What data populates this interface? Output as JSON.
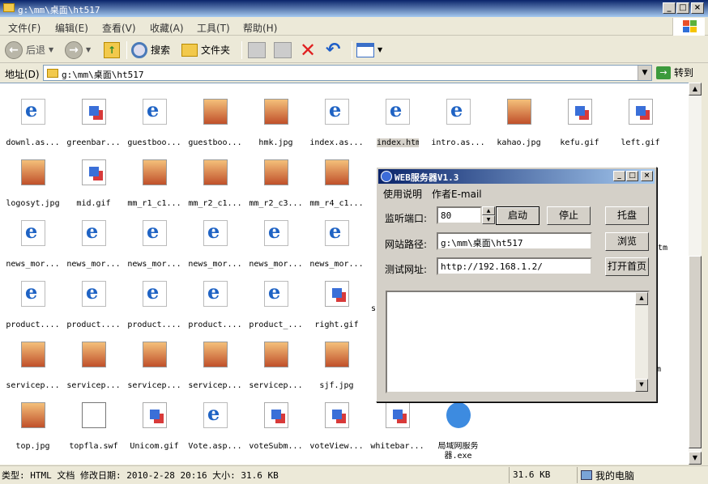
{
  "window": {
    "title": "g:\\mm\\桌面\\ht517"
  },
  "menu": {
    "items": [
      "文件(F)",
      "编辑(E)",
      "查看(V)",
      "收藏(A)",
      "工具(T)",
      "帮助(H)"
    ]
  },
  "toolbar": {
    "back": "后退",
    "search": "搜索",
    "folders": "文件夹"
  },
  "address": {
    "label": "地址(D)",
    "value": "g:\\mm\\桌面\\ht517",
    "go": "转到"
  },
  "files": [
    {
      "name": "downl.as...",
      "type": "ie"
    },
    {
      "name": "greenbar...",
      "type": "gif"
    },
    {
      "name": "guestboo...",
      "type": "ie"
    },
    {
      "name": "guestboo...",
      "type": "jpg"
    },
    {
      "name": "hmk.jpg",
      "type": "jpg"
    },
    {
      "name": "index.as...",
      "type": "ie"
    },
    {
      "name": "index.htm",
      "type": "ie"
    },
    {
      "name": "intro.as...",
      "type": "ie"
    },
    {
      "name": "kahao.jpg",
      "type": "jpg"
    },
    {
      "name": "kefu.gif",
      "type": "gif"
    },
    {
      "name": "left.gif",
      "type": "gif"
    },
    {
      "name": "logosyt.jpg",
      "type": "jpg"
    },
    {
      "name": "mid.gif",
      "type": "gif"
    },
    {
      "name": "mm_r1_c1...",
      "type": "jpg"
    },
    {
      "name": "mm_r2_c1...",
      "type": "jpg"
    },
    {
      "name": "mm_r2_c3...",
      "type": "jpg"
    },
    {
      "name": "mm_r4_c1...",
      "type": "jpg"
    },
    {
      "name": "news_mor...",
      "type": "ie"
    },
    {
      "name": "news_mor...",
      "type": "ie"
    },
    {
      "name": "news_mor...",
      "type": "ie"
    },
    {
      "name": "news_mor...",
      "type": "ie"
    },
    {
      "name": "news_mor...",
      "type": "ie"
    },
    {
      "name": "news_mor...",
      "type": "ie"
    },
    {
      "name": "product....",
      "type": "ie"
    },
    {
      "name": "product....",
      "type": "ie"
    },
    {
      "name": "product....",
      "type": "ie"
    },
    {
      "name": "product....",
      "type": "ie"
    },
    {
      "name": "product_...",
      "type": "ie"
    },
    {
      "name": "right.gif",
      "type": "gif"
    },
    {
      "name": "servicep...",
      "type": "jpg"
    },
    {
      "name": "servicep...",
      "type": "jpg"
    },
    {
      "name": "servicep...",
      "type": "jpg"
    },
    {
      "name": "servicep...",
      "type": "jpg"
    },
    {
      "name": "servicep...",
      "type": "jpg"
    },
    {
      "name": "sjf.jpg",
      "type": "jpg"
    },
    {
      "name": "top.jpg",
      "type": "jpg"
    },
    {
      "name": "topfla.swf",
      "type": "swf"
    },
    {
      "name": "Unicom.gif",
      "type": "gif"
    },
    {
      "name": "Vote.asp...",
      "type": "ie"
    },
    {
      "name": "voteSubm...",
      "type": "gif"
    },
    {
      "name": "voteView...",
      "type": "gif"
    },
    {
      "name": "whitebar...",
      "type": "gif"
    },
    {
      "name": "局域网服务器.exe",
      "type": "exe"
    }
  ],
  "partial_labels": [
    "...",
    "s",
    "...",
    "tm",
    "...",
    "m"
  ],
  "status": {
    "left": "类型: HTML 文档 修改日期: 2010-2-28 20:16 大小: 31.6 KB",
    "size": "31.6 KB",
    "zone": "我的电脑"
  },
  "dialog": {
    "title": "WEB服务器V1.3",
    "menu": [
      "使用说明",
      "作者E-mail"
    ],
    "port_label": "监听端口:",
    "port_value": "80",
    "path_label": "网站路径:",
    "path_value": "g:\\mm\\桌面\\ht517",
    "url_label": "测试网址:",
    "url_value": "http://192.168.1.2/",
    "start": "启动",
    "stop": "停止",
    "tray": "托盘",
    "browse": "浏览",
    "open_home": "打开首页"
  }
}
